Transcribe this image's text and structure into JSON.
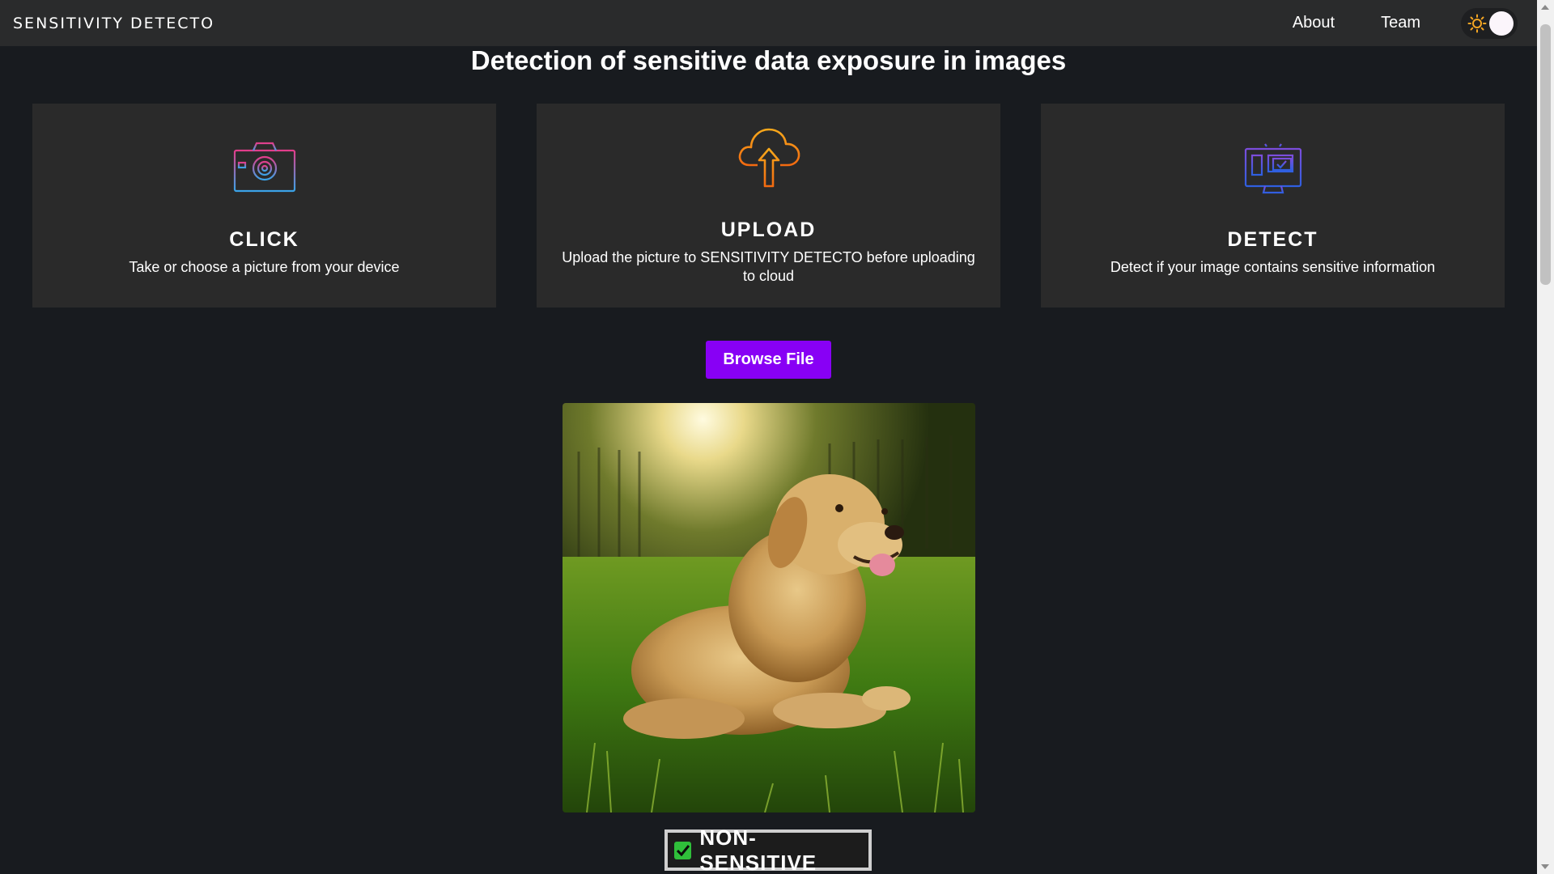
{
  "navbar": {
    "brand": "SENSITIVITY DETECTO",
    "links": [
      {
        "label": "About"
      },
      {
        "label": "Team"
      }
    ],
    "theme_toggle": {
      "icon": "sun-icon",
      "sun_color": "#f5a623",
      "knob_color": "#fbf5fb"
    }
  },
  "main": {
    "title": "Detection of sensitive data exposure in images",
    "cards": [
      {
        "icon": "camera-icon",
        "title": "CLICK",
        "description": "Take or choose a picture from your device"
      },
      {
        "icon": "cloud-upload-icon",
        "title": "UPLOAD",
        "description": "Upload the picture to SENSITIVITY DETECTO before uploading to cloud"
      },
      {
        "icon": "monitor-detect-icon",
        "title": "DETECT",
        "description": "Detect if your image contains sensitive information"
      }
    ],
    "browse_button": "Browse File",
    "preview_image": "golden-retriever-photo",
    "result": {
      "label": "NON-SENSITIVE",
      "icon": "checkbox-checked-icon",
      "color": "#2fbf3a"
    }
  },
  "colors": {
    "background": "#181b1f",
    "navbar": "#2a2b2c",
    "card": "#2a2a2a",
    "accent": "#8800f5"
  }
}
